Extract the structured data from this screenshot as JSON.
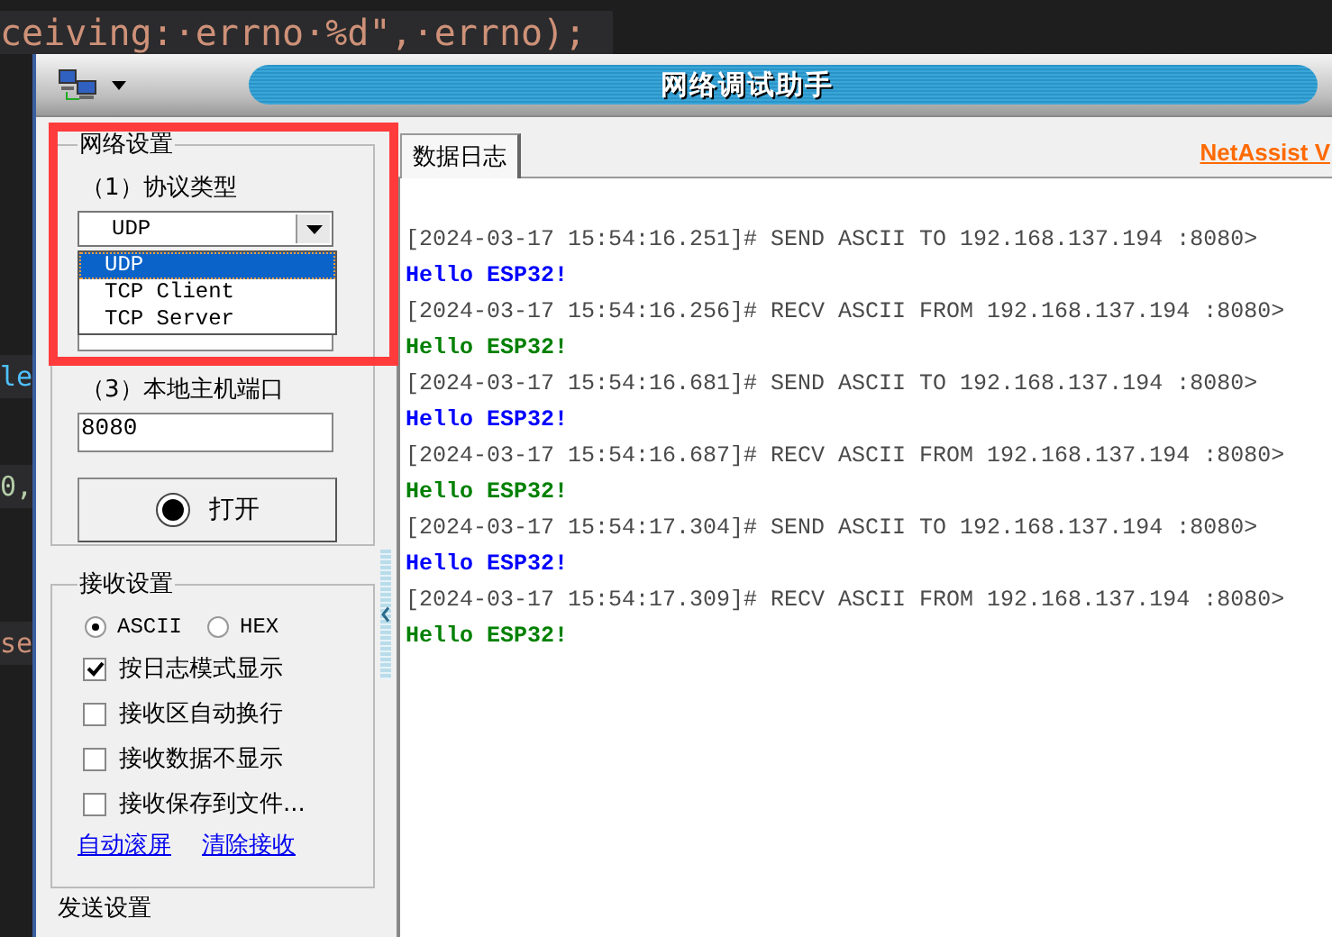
{
  "editor_background": {
    "lines": [
      {
        "text": "ceiving:·errno·%d\",·errno);",
        "color": "#ce9178"
      },
      {
        "text": "le",
        "color": "#4fc1ff"
      },
      {
        "text": "0,",
        "color": "#b5cea8"
      },
      {
        "text": "se",
        "color": "#ce9178"
      }
    ]
  },
  "window": {
    "title": "网络调试助手"
  },
  "tabs": [
    {
      "label": "数据日志",
      "selected": true
    }
  ],
  "brand_link": "NetAssist V",
  "network_settings": {
    "title": "网络设置",
    "protocol_label": "（1）协议类型",
    "protocol_value": "UDP",
    "protocol_options": [
      {
        "label": "UDP",
        "selected": true
      },
      {
        "label": "TCP Client",
        "selected": false
      },
      {
        "label": "TCP Server",
        "selected": false
      }
    ],
    "port_label": "（3）本地主机端口",
    "port_value": "8080",
    "open_button": "打开"
  },
  "receive_settings": {
    "title": "接收设置",
    "encodings": [
      {
        "label": "ASCII",
        "selected": true
      },
      {
        "label": "HEX",
        "selected": false
      }
    ],
    "options": [
      {
        "label": "按日志模式显示",
        "checked": true
      },
      {
        "label": "接收区自动换行",
        "checked": false
      },
      {
        "label": "接收数据不显示",
        "checked": false
      },
      {
        "label": "接收保存到文件...",
        "checked": false
      }
    ],
    "links": [
      "自动滚屏",
      "清除接收"
    ]
  },
  "send_settings": {
    "title": "发送设置"
  },
  "log": [
    {
      "kind": "header",
      "text": "[2024-03-17 15:54:16.251]# SEND ASCII TO 192.168.137.194 :8080>"
    },
    {
      "kind": "sent",
      "text": "Hello ESP32!"
    },
    {
      "kind": "header",
      "text": "[2024-03-17 15:54:16.256]# RECV ASCII FROM 192.168.137.194 :8080>"
    },
    {
      "kind": "received",
      "text": "Hello ESP32!"
    },
    {
      "kind": "header",
      "text": "[2024-03-17 15:54:16.681]# SEND ASCII TO 192.168.137.194 :8080>"
    },
    {
      "kind": "sent",
      "text": "Hello ESP32!"
    },
    {
      "kind": "header",
      "text": "[2024-03-17 15:54:16.687]# RECV ASCII FROM 192.168.137.194 :8080>"
    },
    {
      "kind": "received",
      "text": "Hello ESP32!"
    },
    {
      "kind": "header",
      "text": "[2024-03-17 15:54:17.304]# SEND ASCII TO 192.168.137.194 :8080>"
    },
    {
      "kind": "sent",
      "text": "Hello ESP32!"
    },
    {
      "kind": "header",
      "text": "[2024-03-17 15:54:17.309]# RECV ASCII FROM 192.168.137.194 :8080>"
    },
    {
      "kind": "received",
      "text": "Hello ESP32!"
    }
  ]
}
